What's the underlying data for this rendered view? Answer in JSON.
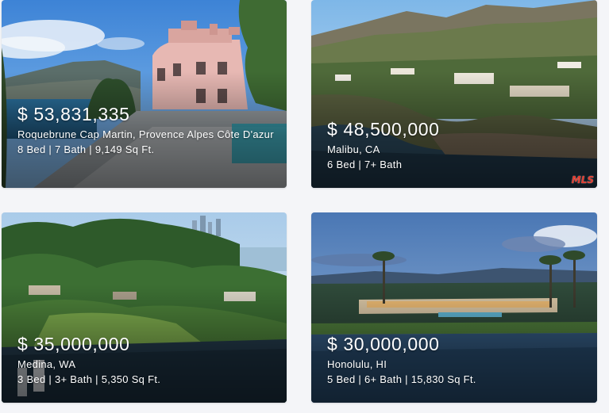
{
  "listings": [
    {
      "price": "$ 53,831,335",
      "location": "Roquebrune Cap Martin, Provence Alpes Côte D'azur",
      "specs": "8 Bed | 7 Bath | 9,149 Sq Ft.",
      "image": "pink-villa-riviera-photo"
    },
    {
      "price": "$ 48,500,000",
      "location": "Malibu, CA",
      "specs": "6 Bed | 7+ Bath",
      "image": "malibu-cliff-estate-photo",
      "watermark": "MLS"
    },
    {
      "price": "$ 35,000,000",
      "location": "Medina, WA",
      "specs": "3 Bed | 3+ Bath | 5,350 Sq Ft.",
      "image": "medina-lakefront-forest-photo"
    },
    {
      "price": "$ 30,000,000",
      "location": "Honolulu, HI",
      "specs": "5 Bed | 6+ Bath | 15,830 Sq Ft.",
      "image": "honolulu-waterfront-dusk-photo"
    }
  ]
}
